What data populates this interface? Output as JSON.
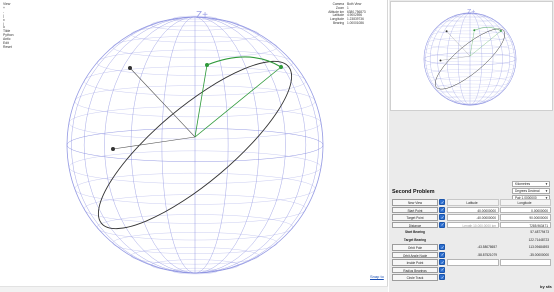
{
  "main": {
    "axis_label": "Z+",
    "menu": [
      "View",
      "+",
      "-",
      "|",
      "x",
      "|",
      "o",
      "Tilde",
      "Python",
      "Antic",
      "Edit",
      "Reset"
    ],
    "info": [
      {
        "key": "Camera",
        "value": "Both View"
      },
      {
        "key": "Zoom",
        "value": "1"
      },
      {
        "key": "Altitude km",
        "value": "6380.756873"
      },
      {
        "key": "Latitude",
        "value": "4.9002596"
      },
      {
        "key": "Longitude",
        "value": "1.23839736"
      },
      {
        "key": "Bearing",
        "value": "1.00001086"
      }
    ],
    "view_link": "Snap to",
    "sphere_color": "#8a8fe0",
    "path_color": "#2f9a3a"
  },
  "mini": {
    "axis_label": "Z+"
  },
  "selects": [
    {
      "value": "Kilometres"
    },
    {
      "value": "Degrees Decimal"
    },
    {
      "value": "Pair 1.0000000"
    }
  ],
  "problem_title": "Second Problem",
  "table": {
    "headers": {
      "view": "New View",
      "latitude": "Latitude",
      "longitude": "Longitude"
    },
    "start_point": {
      "label": "Start Point",
      "lat": "40.00000000",
      "lon": "0.00000000"
    },
    "target_point": {
      "label": "Target Point",
      "lat": "-40.00000000",
      "lon": "90.00000000"
    },
    "distance": {
      "label": "Distance",
      "lat": "Length 10,000.0000 km",
      "lon": "7285.963471"
    },
    "start_bearing": {
      "label": "Start Bearing",
      "value": "57.48779473"
    },
    "target_bearing": {
      "label": "Target Bearing",
      "value": "122.71448723"
    },
    "orbit_pole": {
      "label": "Orbit Pole",
      "lat": "-43.58078657",
      "lon": "113.09484593"
    },
    "orbit_angle_node": {
      "label": "Orbit Angle Node",
      "lat": "-58.87521079",
      "lon": "-35.00000000"
    },
    "inner_point": {
      "label": "Inside Point"
    },
    "radius_bearings": {
      "label": "Radius Bearings"
    },
    "circle_track": {
      "label": "Circle Track"
    }
  },
  "footer": {
    "by": "by sfa"
  }
}
